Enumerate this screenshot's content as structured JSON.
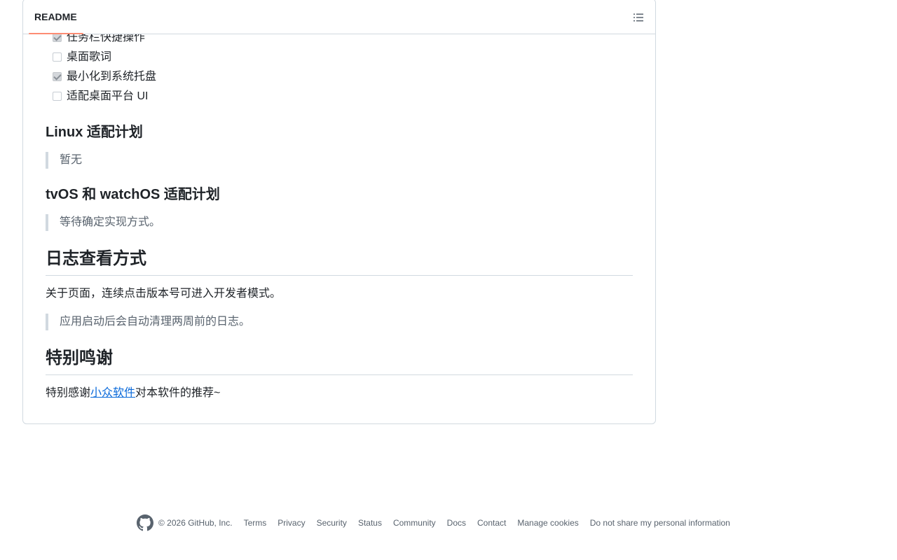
{
  "readme": {
    "tab_label": "README",
    "outline_icon": "list-unordered-icon"
  },
  "tasks": [
    {
      "label": "任务栏快捷操作",
      "checked": true
    },
    {
      "label": "桌面歌词",
      "checked": false
    },
    {
      "label": "最小化到系统托盘",
      "checked": true
    },
    {
      "label": "适配桌面平台 UI",
      "checked": false
    }
  ],
  "sections": {
    "linux_heading": "Linux 适配计划",
    "linux_quote": "暂无",
    "tvos_heading": "tvOS 和 watchOS 适配计划",
    "tvos_quote": "等待确定实现方式。",
    "logs_heading": "日志查看方式",
    "logs_paragraph": "关于页面，连续点击版本号可进入开发者模式。",
    "logs_quote": "应用启动后会自动清理两周前的日志。",
    "thanks_heading": "特别鸣谢",
    "thanks_before": "特别感谢",
    "thanks_link": "小众软件",
    "thanks_after": "对本软件的推荐~"
  },
  "footer": {
    "logo_icon": "github-logo-icon",
    "copyright": "© 2026 GitHub, Inc.",
    "links": [
      "Terms",
      "Privacy",
      "Security",
      "Status",
      "Community",
      "Docs",
      "Contact",
      "Manage cookies",
      "Do not share my personal information"
    ]
  },
  "colors": {
    "accent_underline": "#fd8c73",
    "link": "#0969da",
    "border": "#d1d9e0",
    "muted_text": "#59636e"
  }
}
